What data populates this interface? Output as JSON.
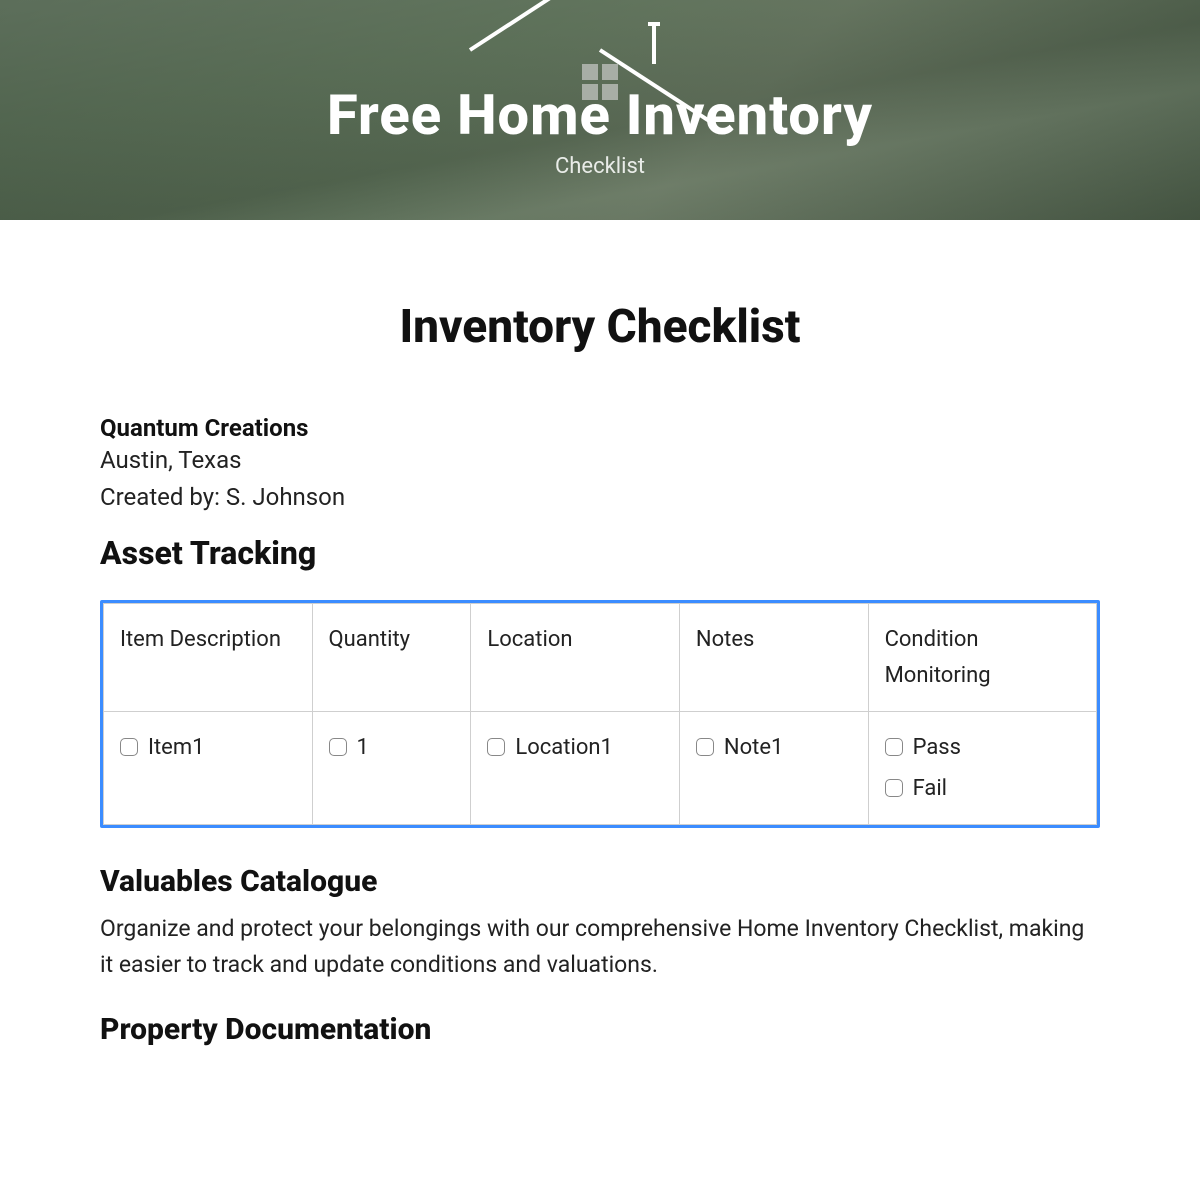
{
  "hero": {
    "title": "Free Home Inventory",
    "subtitle": "Checklist"
  },
  "doc": {
    "title": "Inventory Checklist",
    "org": "Quantum Creations",
    "location": "Austin, Texas",
    "created_by_label": "Created by: ",
    "created_by": "S. Johnson"
  },
  "sections": {
    "asset_tracking": "Asset Tracking",
    "valuables": "Valuables Catalogue",
    "valuables_body": "Organize and protect your belongings with our comprehensive Home Inventory Checklist, making it easier to track and update conditions and valuations.",
    "property_doc": "Property Documentation"
  },
  "table": {
    "headers": [
      "Item Description",
      "Quantity",
      "Location",
      "Notes",
      "Condition Monitoring"
    ],
    "row": {
      "item": "Item1",
      "qty": "1",
      "location": "Location1",
      "notes": "Note1",
      "cond_pass": "Pass",
      "cond_fail": "Fail"
    }
  }
}
